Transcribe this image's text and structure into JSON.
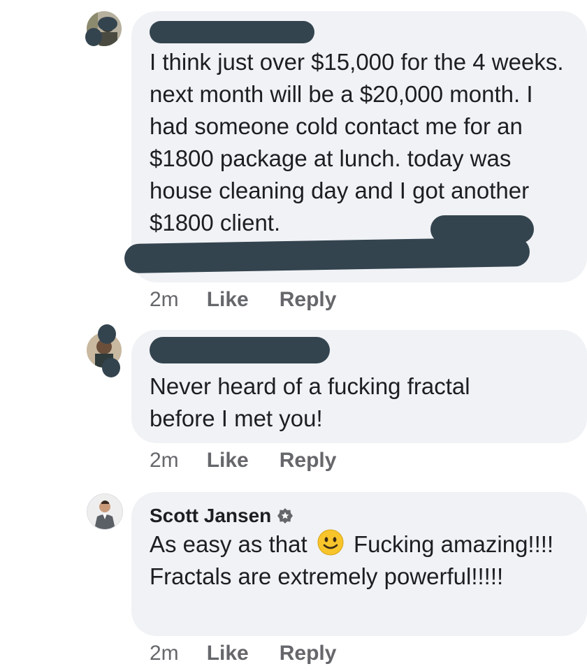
{
  "comments": [
    {
      "author": "",
      "author_redacted": true,
      "text": "I think just over $15,000 for the 4 weeks. next month will be a $20,000 month. I had someone cold contact me for an $1800 package at lunch. today was house cleaning day and I got another $1800 client.",
      "text_redacted_tail": true,
      "time": "2m",
      "like_label": "Like",
      "reply_label": "Reply"
    },
    {
      "author": "",
      "author_redacted": true,
      "text": "Never heard of a fucking fractal before I met you!",
      "time": "2m",
      "like_label": "Like",
      "reply_label": "Reply"
    },
    {
      "author": "Scott Jansen",
      "verified": true,
      "text_before_emoji": "As easy as that",
      "emoji": "slightly-smiling-face",
      "text_after_emoji": "Fucking amazing!!!! Fractals are extremely powerful!!!!!",
      "time": "2m",
      "like_label": "Like",
      "reply_label": "Reply"
    }
  ],
  "colors": {
    "bubble": "#f0f2f5",
    "meta_text": "#65676b",
    "redaction": "#34444f"
  }
}
